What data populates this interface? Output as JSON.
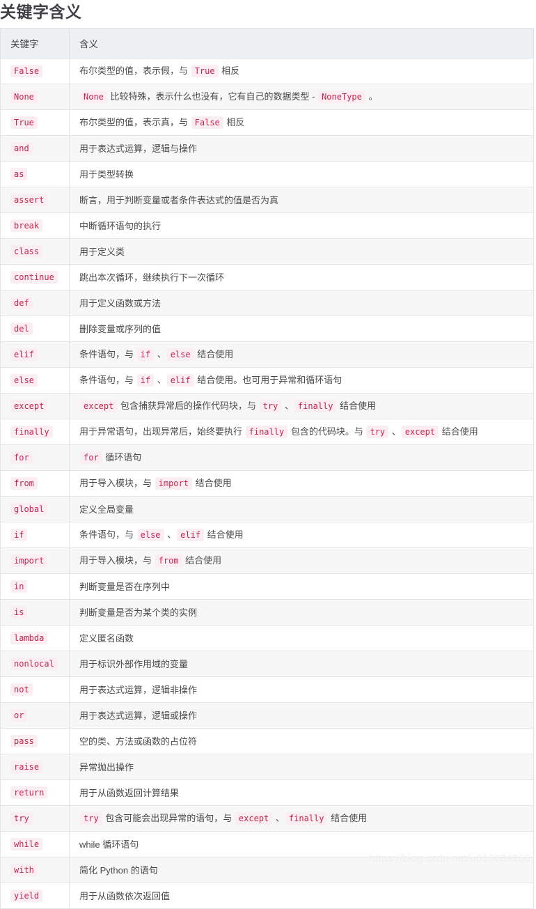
{
  "page": {
    "title": "关键字含义",
    "watermark": "https://blog.csdn.net/u013084266"
  },
  "table": {
    "columns": [
      {
        "key": "keyword",
        "label": "关键字"
      },
      {
        "key": "meaning",
        "label": "含义"
      }
    ],
    "rows": [
      {
        "keyword": "False",
        "meaning_parts": [
          {
            "t": "text",
            "v": "布尔类型的值，表示假，与 "
          },
          {
            "t": "code",
            "v": "True"
          },
          {
            "t": "text",
            "v": " 相反"
          }
        ]
      },
      {
        "keyword": "None",
        "meaning_parts": [
          {
            "t": "code",
            "v": "None"
          },
          {
            "t": "text",
            "v": " 比较特殊，表示什么也没有，它有自己的数据类型 - "
          },
          {
            "t": "code",
            "v": "NoneType"
          },
          {
            "t": "text",
            "v": " 。"
          }
        ]
      },
      {
        "keyword": "True",
        "meaning_parts": [
          {
            "t": "text",
            "v": "布尔类型的值，表示真，与 "
          },
          {
            "t": "code",
            "v": "False"
          },
          {
            "t": "text",
            "v": " 相反"
          }
        ]
      },
      {
        "keyword": "and",
        "meaning_parts": [
          {
            "t": "text",
            "v": "用于表达式运算，逻辑与操作"
          }
        ]
      },
      {
        "keyword": "as",
        "meaning_parts": [
          {
            "t": "text",
            "v": "用于类型转换"
          }
        ]
      },
      {
        "keyword": "assert",
        "meaning_parts": [
          {
            "t": "text",
            "v": "断言，用于判断变量或者条件表达式的值是否为真"
          }
        ]
      },
      {
        "keyword": "break",
        "meaning_parts": [
          {
            "t": "text",
            "v": "中断循环语句的执行"
          }
        ]
      },
      {
        "keyword": "class",
        "meaning_parts": [
          {
            "t": "text",
            "v": "用于定义类"
          }
        ]
      },
      {
        "keyword": "continue",
        "meaning_parts": [
          {
            "t": "text",
            "v": "跳出本次循环，继续执行下一次循环"
          }
        ]
      },
      {
        "keyword": "def",
        "meaning_parts": [
          {
            "t": "text",
            "v": "用于定义函数或方法"
          }
        ]
      },
      {
        "keyword": "del",
        "meaning_parts": [
          {
            "t": "text",
            "v": "删除变量或序列的值"
          }
        ]
      },
      {
        "keyword": "elif",
        "meaning_parts": [
          {
            "t": "text",
            "v": "条件语句，与 "
          },
          {
            "t": "code",
            "v": "if"
          },
          {
            "t": "text",
            "v": " 、"
          },
          {
            "t": "code",
            "v": "else"
          },
          {
            "t": "text",
            "v": " 结合使用"
          }
        ]
      },
      {
        "keyword": "else",
        "meaning_parts": [
          {
            "t": "text",
            "v": "条件语句，与 "
          },
          {
            "t": "code",
            "v": "if"
          },
          {
            "t": "text",
            "v": " 、"
          },
          {
            "t": "code",
            "v": "elif"
          },
          {
            "t": "text",
            "v": " 结合使用。也可用于异常和循环语句"
          }
        ]
      },
      {
        "keyword": "except",
        "meaning_parts": [
          {
            "t": "code",
            "v": "except"
          },
          {
            "t": "text",
            "v": " 包含捕获异常后的操作代码块，与 "
          },
          {
            "t": "code",
            "v": "try"
          },
          {
            "t": "text",
            "v": " 、"
          },
          {
            "t": "code",
            "v": "finally"
          },
          {
            "t": "text",
            "v": " 结合使用"
          }
        ]
      },
      {
        "keyword": "finally",
        "meaning_parts": [
          {
            "t": "text",
            "v": "用于异常语句，出现异常后，始终要执行 "
          },
          {
            "t": "code",
            "v": "finally"
          },
          {
            "t": "text",
            "v": " 包含的代码块。与 "
          },
          {
            "t": "code",
            "v": "try"
          },
          {
            "t": "text",
            "v": " 、"
          },
          {
            "t": "code",
            "v": "except"
          },
          {
            "t": "text",
            "v": " 结合使用"
          }
        ]
      },
      {
        "keyword": "for",
        "meaning_parts": [
          {
            "t": "code",
            "v": "for"
          },
          {
            "t": "text",
            "v": " 循环语句"
          }
        ]
      },
      {
        "keyword": "from",
        "meaning_parts": [
          {
            "t": "text",
            "v": "用于导入模块，与 "
          },
          {
            "t": "code",
            "v": "import"
          },
          {
            "t": "text",
            "v": " 结合使用"
          }
        ]
      },
      {
        "keyword": "global",
        "meaning_parts": [
          {
            "t": "text",
            "v": "定义全局变量"
          }
        ]
      },
      {
        "keyword": "if",
        "meaning_parts": [
          {
            "t": "text",
            "v": "条件语句，与 "
          },
          {
            "t": "code",
            "v": "else"
          },
          {
            "t": "text",
            "v": " 、"
          },
          {
            "t": "code",
            "v": "elif"
          },
          {
            "t": "text",
            "v": " 结合使用"
          }
        ]
      },
      {
        "keyword": "import",
        "meaning_parts": [
          {
            "t": "text",
            "v": "用于导入模块，与 "
          },
          {
            "t": "code",
            "v": "from"
          },
          {
            "t": "text",
            "v": " 结合使用"
          }
        ]
      },
      {
        "keyword": "in",
        "meaning_parts": [
          {
            "t": "text",
            "v": "判断变量是否在序列中"
          }
        ]
      },
      {
        "keyword": "is",
        "meaning_parts": [
          {
            "t": "text",
            "v": "判断变量是否为某个类的实例"
          }
        ]
      },
      {
        "keyword": "lambda",
        "meaning_parts": [
          {
            "t": "text",
            "v": "定义匿名函数"
          }
        ]
      },
      {
        "keyword": "nonlocal",
        "meaning_parts": [
          {
            "t": "text",
            "v": "用于标识外部作用域的变量"
          }
        ]
      },
      {
        "keyword": "not",
        "meaning_parts": [
          {
            "t": "text",
            "v": "用于表达式运算，逻辑非操作"
          }
        ]
      },
      {
        "keyword": "or",
        "meaning_parts": [
          {
            "t": "text",
            "v": "用于表达式运算，逻辑或操作"
          }
        ]
      },
      {
        "keyword": "pass",
        "meaning_parts": [
          {
            "t": "text",
            "v": "空的类、方法或函数的占位符"
          }
        ]
      },
      {
        "keyword": "raise",
        "meaning_parts": [
          {
            "t": "text",
            "v": "异常抛出操作"
          }
        ]
      },
      {
        "keyword": "return",
        "meaning_parts": [
          {
            "t": "text",
            "v": "用于从函数返回计算结果"
          }
        ]
      },
      {
        "keyword": "try",
        "meaning_parts": [
          {
            "t": "code",
            "v": "try"
          },
          {
            "t": "text",
            "v": " 包含可能会出现异常的语句，与 "
          },
          {
            "t": "code",
            "v": "except"
          },
          {
            "t": "text",
            "v": " 、"
          },
          {
            "t": "code",
            "v": "finally"
          },
          {
            "t": "text",
            "v": " 结合使用"
          }
        ]
      },
      {
        "keyword": "while",
        "meaning_parts": [
          {
            "t": "text",
            "v": "while 循环语句"
          }
        ]
      },
      {
        "keyword": "with",
        "meaning_parts": [
          {
            "t": "text",
            "v": "简化 Python 的语句"
          }
        ]
      },
      {
        "keyword": "yield",
        "meaning_parts": [
          {
            "t": "text",
            "v": "用于从函数依次返回值"
          }
        ]
      }
    ]
  }
}
